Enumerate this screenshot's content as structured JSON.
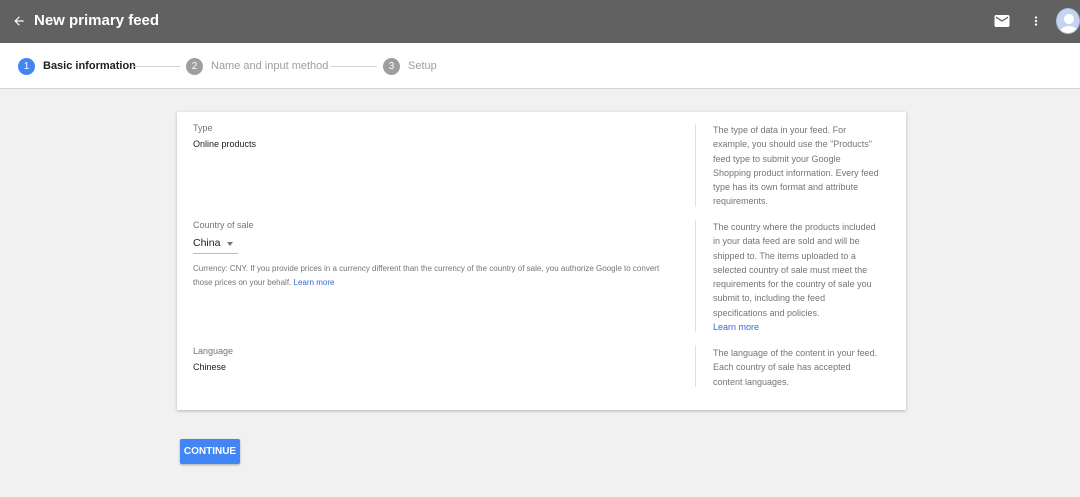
{
  "header": {
    "title": "New primary feed",
    "icons": {
      "back": "arrow-back-icon",
      "mail": "mail-icon",
      "more": "more-vert-icon",
      "avatar": "account-avatar"
    },
    "colors": {
      "bar": "#616161"
    }
  },
  "stepper": {
    "steps": [
      {
        "number": "1",
        "label": "Basic information",
        "state": "active"
      },
      {
        "number": "2",
        "label": "Name and input method",
        "state": "inactive"
      },
      {
        "number": "3",
        "label": "Setup",
        "state": "inactive"
      }
    ],
    "colors": {
      "active": "#4285f4",
      "inactive": "#9e9e9e"
    }
  },
  "form": {
    "type": {
      "label": "Type",
      "value": "Online products",
      "help": "The type of data in your feed. For example, you should use the \"Products\" feed type to submit your Google Shopping product information. Every feed type has its own format and attribute requirements."
    },
    "country": {
      "label": "Country of sale",
      "value": "China",
      "currency_note": "Currency: CNY. If you provide prices in a currency different than the currency of the country of sale, you authorize Google to convert those prices on your behalf.",
      "currency_link": "Learn more",
      "help": "The country where the products included in your data feed are sold and will be shipped to. The items uploaded to a selected country of sale must meet the requirements for the country of sale you submit to, including the feed specifications and policies.",
      "help_link": "Learn more"
    },
    "language": {
      "label": "Language",
      "value": "Chinese",
      "help": "The language of the content in your feed. Each country of sale has accepted content languages."
    }
  },
  "actions": {
    "continue_label": "CONTINUE",
    "colors": {
      "primary": "#4285f4"
    }
  }
}
